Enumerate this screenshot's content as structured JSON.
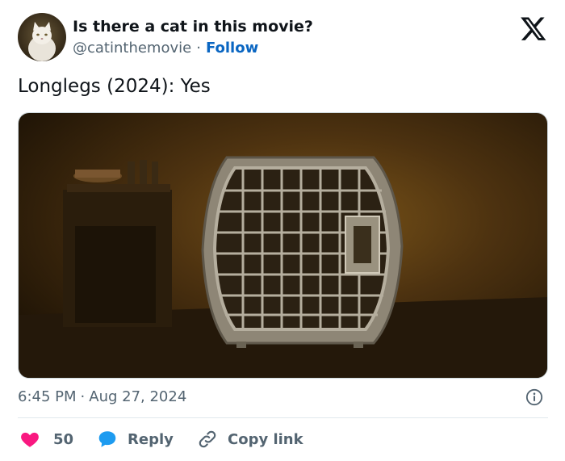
{
  "author": {
    "display_name": "Is there a cat in this movie?",
    "handle": "@catinthemovie",
    "separator": "·",
    "follow_label": "Follow",
    "avatar_icon": "white-cat-avatar"
  },
  "brand": {
    "logo_icon": "x-logo-icon"
  },
  "tweet": {
    "text": "Longlegs (2024): Yes",
    "media_icon": "pet-carrier-still-image"
  },
  "meta": {
    "time": "6:45 PM",
    "separator": "·",
    "date": "Aug 27, 2024",
    "info_icon": "info-icon"
  },
  "actions": {
    "like_count": "50",
    "like_icon": "heart-icon",
    "reply_label": "Reply",
    "reply_icon": "speech-bubble-icon",
    "copy_label": "Copy link",
    "copy_icon": "link-icon"
  },
  "colors": {
    "accent": "#0a66c2",
    "text_primary": "#0f1419",
    "text_secondary": "#536471",
    "like": "#f91880",
    "reply": "#1d9bf0"
  }
}
